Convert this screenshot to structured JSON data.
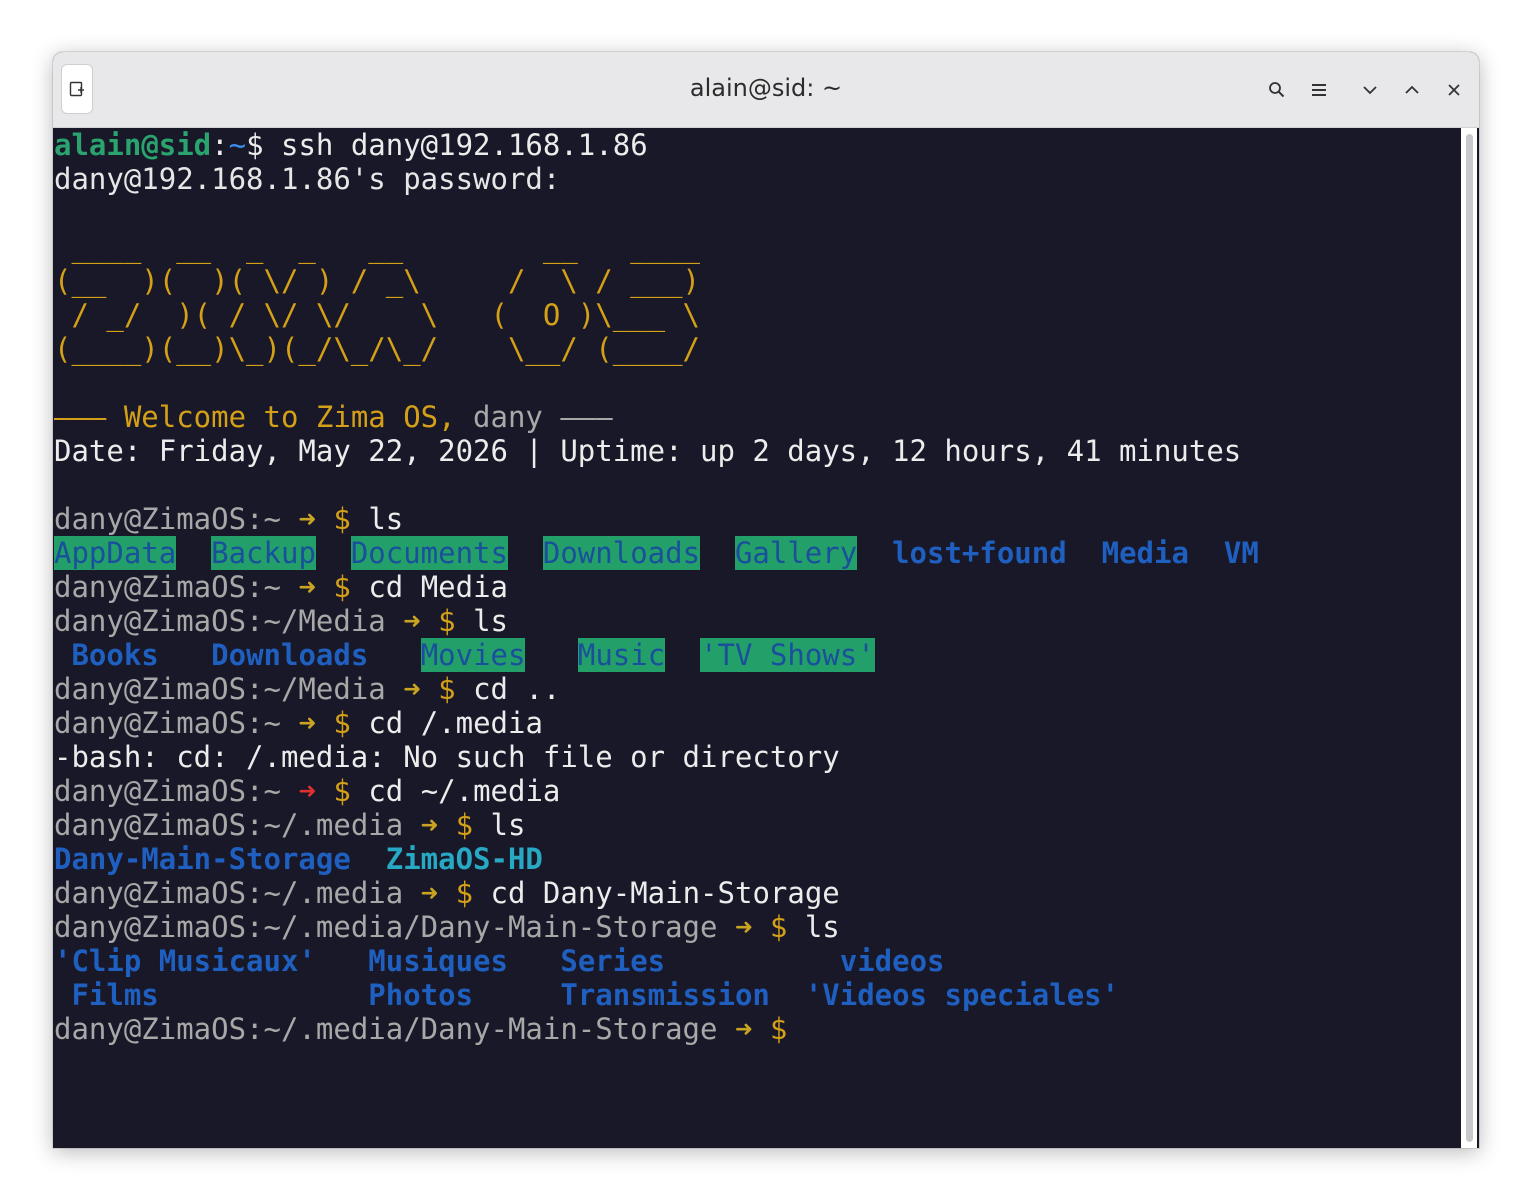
{
  "window": {
    "title": "alain@sid: ~"
  },
  "icons": {
    "new_tab": "new-tab-icon",
    "search": "search-icon",
    "menu": "hamburger-menu-icon",
    "minimize": "chevron-down-icon",
    "maximize": "chevron-up-icon",
    "close": "close-icon"
  },
  "colors": {
    "terminal_bg": "#181828",
    "titlebar_bg": "#e8e8ea",
    "prompt_green": "#2aa36e",
    "banner_yellow": "#d4a017",
    "dir_blue": "#1f5fbf",
    "dir_highlight_bg": "#23a06a",
    "error_arrow": "#e03030",
    "cyan_dir": "#27a9c4"
  },
  "terminal": {
    "local_prompt": {
      "user_host": "alain@sid",
      "colon": ":",
      "cwd": "~",
      "dollar": "$ ",
      "command": "ssh dany@192.168.1.86"
    },
    "password_prompt": "dany@192.168.1.86's password:",
    "banner_art": [
      " ____  __  _  _   __        __   ____",
      "(__  )(  )( \\/ ) / _\\     /  \\ / ___)",
      " / _/  )( / \\/ \\/    \\   (  O )\\___ \\",
      "(____)(__)\\_)(_/\\_/\\_/    \\__/ (____/"
    ],
    "welcome": {
      "dash_left": "——— ",
      "text": "Welcome to Zima OS, ",
      "user": "dany",
      "dash_right": " ———"
    },
    "status_line": "Date: Friday, May 22, 2026 | Uptime: up 2 days, 12 hours, 41 minutes",
    "remote_user_host": "dany@ZimaOS:",
    "arrow": "➜",
    "dollar": "$",
    "session": [
      {
        "cwd": "~",
        "command": "ls"
      },
      {
        "cwd": "~",
        "command": "cd Media"
      },
      {
        "cwd": "~/Media",
        "command": "ls"
      },
      {
        "cwd": "~/Media",
        "command": "cd .."
      },
      {
        "cwd": "~",
        "command": "cd /.media"
      },
      {
        "cwd": "~",
        "command": "cd ~/.media"
      },
      {
        "cwd": "~/.media",
        "command": "ls"
      },
      {
        "cwd": "~/.media",
        "command": "cd Dany-Main-Storage"
      },
      {
        "cwd": "~/.media/Dany-Main-Storage",
        "command": "ls"
      },
      {
        "cwd": "~/.media/Dany-Main-Storage",
        "command": ""
      }
    ],
    "ls_home": [
      "AppData",
      "Backup",
      "Documents",
      "Downloads",
      "Gallery",
      "lost+found",
      "Media",
      "VM"
    ],
    "ls_media": [
      "Books",
      "Downloads",
      "Movies",
      "Music",
      "'TV Shows'"
    ],
    "error_message": "-bash: cd: /.media: No such file or directory",
    "ls_dot_media": [
      "Dany-Main-Storage",
      "ZimaOS-HD"
    ],
    "ls_storage_row1": [
      "'Clip Musicaux'",
      "Musiques",
      "Series",
      "videos"
    ],
    "ls_storage_row2": [
      "Films",
      "Photos",
      "Transmission",
      "'Videos speciales'"
    ]
  }
}
